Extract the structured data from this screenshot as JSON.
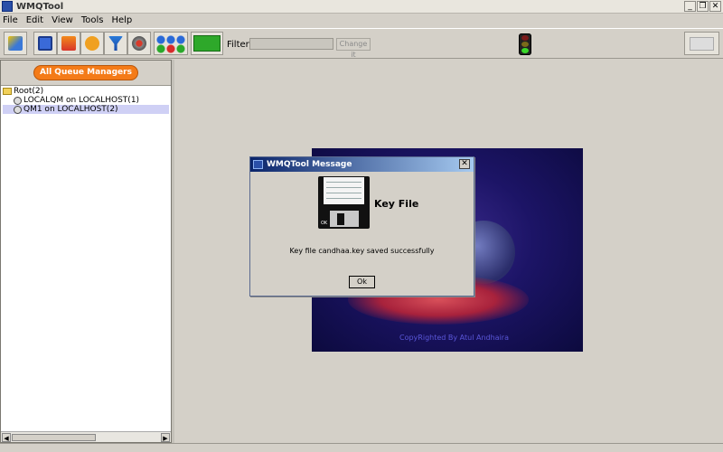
{
  "window": {
    "title": "WMQTool",
    "btn_minimize": "_",
    "btn_restore": "❐",
    "btn_close": "✕"
  },
  "menu": [
    "File",
    "Edit",
    "View",
    "Tools",
    "Help"
  ],
  "toolbar": {
    "filter_label": "Filter:",
    "filter_value": "",
    "change_label": "Change it"
  },
  "left": {
    "header": "All Queue Managers",
    "tree": {
      "root": "Root(2)",
      "items": [
        "LOCALQM on LOCALHOST(1)",
        "QM1 on LOCALHOST(2)"
      ]
    },
    "scroll_left": "◀",
    "scroll_right": "▶"
  },
  "splash": {
    "credit": "CopyRighted By Atul Andhaira"
  },
  "dialog": {
    "title": "WMQTool Message",
    "close": "✕",
    "heading": "Key File",
    "message": "Key file candhaa.key saved successfully",
    "ok_label": "Ok",
    "floppy_label": "OK"
  },
  "colors": {
    "accent_orange": "#f47b18",
    "title_gradient_start": "#0a246a",
    "title_gradient_end": "#a6caf0",
    "selection": "#cfd0f5"
  }
}
